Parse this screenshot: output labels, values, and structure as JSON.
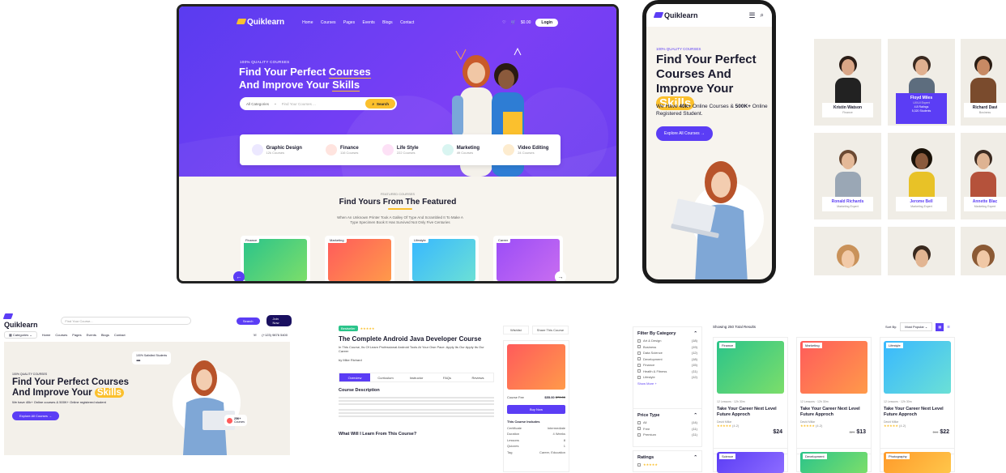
{
  "desktop": {
    "logo": "Quiklearn",
    "nav": [
      "Home",
      "Courses",
      "Pages",
      "Events",
      "Blogs",
      "Contact"
    ],
    "cart": "$0.00",
    "login": "Login",
    "tag": "100% QUALITY COURSES",
    "title_line1_pre": "Find Your Perfect ",
    "title_line1_hl": "Courses",
    "title_line2_pre": "And Improve Your ",
    "title_line2_hl": "Skills",
    "search_cat": "All Categories",
    "search_ph": "Find Your Courses ...",
    "search_btn": "Search",
    "categories": [
      {
        "name": "Graphic Design",
        "count": "12k Courses",
        "color": "#5b3df5"
      },
      {
        "name": "Finance",
        "count": "116 Courses",
        "color": "#ff6b5b"
      },
      {
        "name": "Life Style",
        "count": "222 Courses",
        "color": "#e14ac5"
      },
      {
        "name": "Marketing",
        "count": "49 Courses",
        "color": "#1bb3a4"
      },
      {
        "name": "Video Editing",
        "count": "24 Courses",
        "color": "#f4a93b"
      }
    ],
    "featured_tag": "FEATURED COURSES",
    "featured_title": "Find Yours From The Featured",
    "featured_sub": "When An Unknown Printer Took A Galley Of Type And Scrambled It To Make A Type Specimen Book It Has Survived Not Only Five Centuries",
    "cards": [
      "Finance",
      "Marketing",
      "Lifestyle",
      "Career"
    ]
  },
  "mobile": {
    "logo": "Quiklearn",
    "tag": "100% QUALITY COURSES",
    "l1": "Find Your Perfect",
    "l2": "Courses And",
    "l3": "Improve Your",
    "hl": "Skills",
    "sub_a": "We Have ",
    "sub_b": "40k+",
    "sub_c": " Online Courses & ",
    "sub_d": "500K+",
    "sub_e": " Online Registered Student.",
    "btn": "Explore All Courses →"
  },
  "team": [
    {
      "name": "Kristin Watson",
      "role": "Finance"
    },
    {
      "name": "Floyd Miles",
      "role": "UX/UI Expert"
    },
    {
      "name": "Richard Davi",
      "role": "Business"
    },
    {
      "name": "Ronald Richards",
      "role": "Marketing Expert"
    },
    {
      "name": "Jerome Bell",
      "role": "Marketing Expert"
    },
    {
      "name": "Annette Blac",
      "role": "Marketing Expert"
    }
  ],
  "team_extra": {
    "ratings": "4.8 Ratings",
    "students": "5,320 Students"
  },
  "home2": {
    "logo": "Quiklearn",
    "search_ph": "Find Your Course...",
    "search_btn": "Search",
    "join": "Join Now",
    "cats": "Categories",
    "nav": [
      "Home",
      "Courses",
      "Pages",
      "Events",
      "Blogs",
      "Contact"
    ],
    "phone": "(+123) 9876 5400",
    "tag": "100% QUALITY COURSES",
    "l1": "Find Your Perfect Courses",
    "l2": "And Improve Your",
    "hl": "Skills",
    "sub": "We have 40k+ Online courses & 500K+ Online registered student",
    "btn": "Explore All Courses →",
    "badge1": "100% Satisfied Students",
    "badge2": "25K+",
    "badge3": "Courses"
  },
  "detail": {
    "badge": "Bestseller",
    "title": "The Complete Android Java Developer Course",
    "desc": "In This Course, Its Of Learn Professional Android Tools At Your Own Pace. Apply Its Our Apply Its Our Career",
    "author": "by Mike Richard",
    "tabs": [
      "Overview",
      "Curriculum",
      "Instructor",
      "FAQs",
      "Reviews"
    ],
    "h_desc": "Course Description",
    "h_learn": "What Will I Learn From This Course?",
    "wishlist": "Wishlist",
    "share": "Share This Course",
    "fee_label": "Course Fee",
    "price": "$55.00",
    "old_price": "$70.00",
    "buy": "Buy Now",
    "includes": "This Course Includes",
    "inc": [
      "Certificate",
      "Duration",
      "Lessons",
      "Quizzes",
      "Tag"
    ],
    "inc_val": [
      "Intermediate",
      "4 Weeks",
      "8",
      "1",
      "Career, Education"
    ]
  },
  "listing": {
    "filter_title": "Filter By Category",
    "cats": [
      {
        "n": "Art & Design",
        "c": "(18)"
      },
      {
        "n": "Business",
        "c": "(19)"
      },
      {
        "n": "Data Science",
        "c": "(12)"
      },
      {
        "n": "Development",
        "c": "(18)"
      },
      {
        "n": "Finance",
        "c": "(15)"
      },
      {
        "n": "Health & Fitness",
        "c": "(11)"
      },
      {
        "n": "Lifestyle",
        "c": "(12)"
      }
    ],
    "show_more": "Show More +",
    "price_title": "Price Type",
    "prices": [
      {
        "n": "All",
        "c": "(14)"
      },
      {
        "n": "Free",
        "c": "(11)"
      },
      {
        "n": "Premium",
        "c": "(11)"
      }
    ],
    "ratings_title": "Ratings",
    "results": "Showing 250 Total Results",
    "sort_label": "Sort By:",
    "sort_val": "Most Popular",
    "products": [
      {
        "label": "Finance",
        "title": "Take Your Career Next Level Future Approch",
        "price": "$24",
        "old": ""
      },
      {
        "label": "Marketing",
        "title": "Take Your Career Next Level Future Approch",
        "price": "$13",
        "old": "$29"
      },
      {
        "label": "Lifestyle",
        "title": "Take Your Career Next Level Future Approch",
        "price": "$22",
        "old": "$44"
      }
    ],
    "row2": [
      "Science",
      "Development",
      "Photography"
    ],
    "meta": "12 Lessons",
    "dur": "12h 30m",
    "author": "David Millar",
    "rating": "(4.2)"
  }
}
